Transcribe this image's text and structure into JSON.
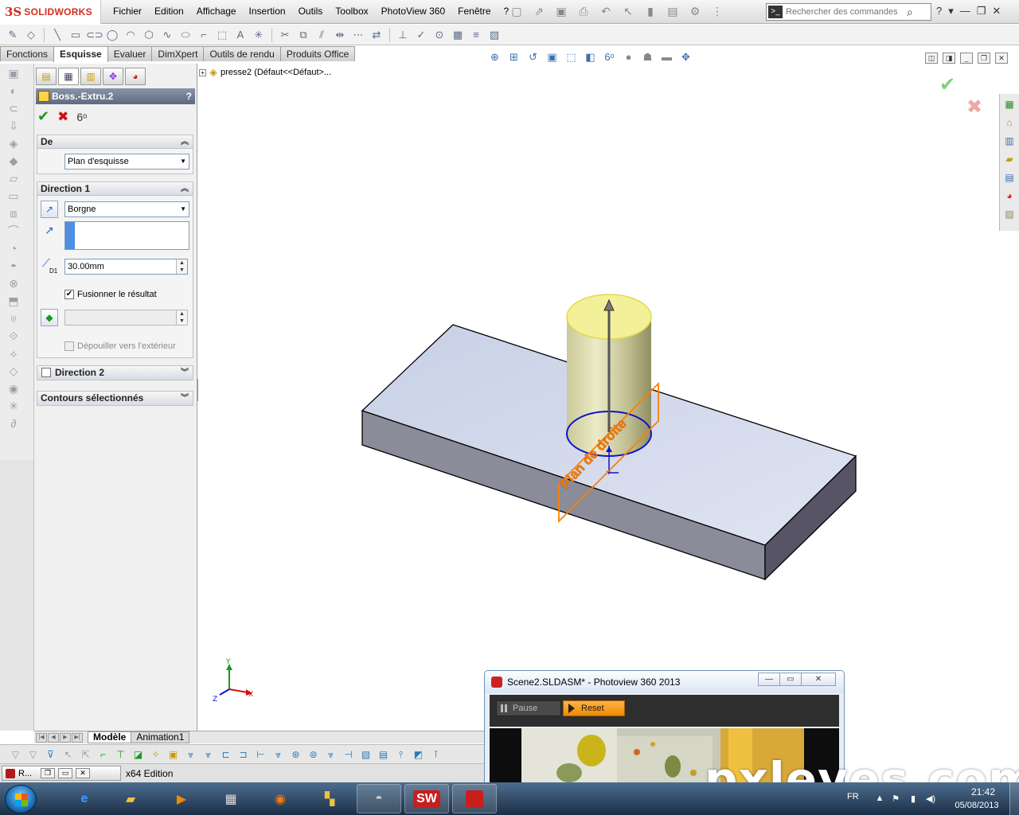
{
  "app": {
    "logo_text": "SOLIDWORKS",
    "brand_color": "#d52b1e"
  },
  "menu": [
    "Fichier",
    "Edition",
    "Affichage",
    "Insertion",
    "Outils",
    "Toolbox",
    "PhotoView 360",
    "Fenêtre",
    "?"
  ],
  "search": {
    "placeholder": "Rechercher des commandes"
  },
  "command_tabs": [
    {
      "label": "Fonctions",
      "active": false
    },
    {
      "label": "Esquisse",
      "active": true
    },
    {
      "label": "Evaluer",
      "active": false
    },
    {
      "label": "DimXpert",
      "active": false
    },
    {
      "label": "Outils de rendu",
      "active": false
    },
    {
      "label": "Produits Office",
      "active": false
    }
  ],
  "property_manager": {
    "title": "Boss.-Extru.2",
    "help": "?",
    "from_group": {
      "title": "De",
      "value": "Plan d'esquisse"
    },
    "direction1": {
      "title": "Direction 1",
      "end_condition": "Borgne",
      "depth": "30.00mm",
      "depth_label": "D1",
      "merge_result": "Fusionner le résultat",
      "merge_checked": true,
      "draft_outward": "Dépouiller vers l'extérieur",
      "draft_checked": false
    },
    "direction2": {
      "title": "Direction 2"
    },
    "selected_contours": {
      "title": "Contours sélectionnés"
    }
  },
  "feature_tree": {
    "root_label": "presse2  (Défaut<<Défaut>..."
  },
  "viewport": {
    "plane_label": "Plan de droite",
    "plane_color": "#ff7f00",
    "sketch_color": "#1212c8",
    "triad": {
      "x": "X",
      "y": "Y",
      "z": "Z"
    }
  },
  "bottom_tabs": [
    {
      "label": "Modèle",
      "active": true
    },
    {
      "label": "Animation1",
      "active": false
    }
  ],
  "status_bar": {
    "edition_text": "x64 Edition",
    "min_window_title": "R..."
  },
  "photoview": {
    "title": "Scene2.SLDASM* - Photoview 360 2013",
    "pause_label": "Pause",
    "reset_label": "Reset",
    "accent_color": "#f08a00"
  },
  "watermark": "pxleyes.com",
  "taskbar": {
    "sw_label": "SW",
    "language": "FR",
    "time": "21:42",
    "date": "05/08/2013"
  }
}
